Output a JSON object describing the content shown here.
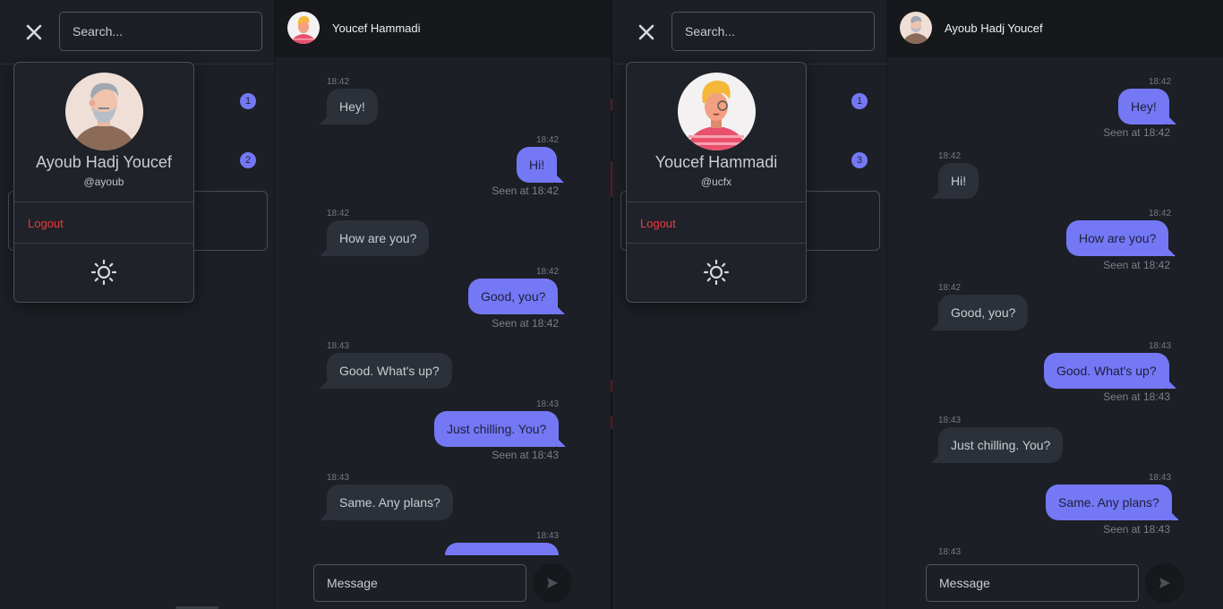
{
  "colors": {
    "accent": "#7478f5",
    "danger": "#f0383f",
    "background": "#1c1f25",
    "header": "#16181c",
    "incoming_bubble": "#2c3038"
  },
  "left": {
    "search": {
      "placeholder": "Search..."
    },
    "badges": [
      "1",
      "2"
    ],
    "profile": {
      "name": "Ayoub Hadj Youcef",
      "handle": "@ayoub",
      "logout_label": "Logout"
    },
    "chat": {
      "title": "Youcef Hammadi",
      "input_placeholder": "Message",
      "messages": [
        {
          "dir": "in",
          "time": "18:42",
          "text": "Hey!"
        },
        {
          "dir": "out",
          "time": "18:42",
          "text": "Hi!",
          "seen": "Seen at 18:42"
        },
        {
          "dir": "in",
          "time": "18:42",
          "text": "How are you?"
        },
        {
          "dir": "out",
          "time": "18:42",
          "text": "Good, you?",
          "seen": "Seen at 18:42"
        },
        {
          "dir": "in",
          "time": "18:43",
          "text": "Good. What's up?"
        },
        {
          "dir": "out",
          "time": "18:43",
          "text": "Just chilling. You?",
          "seen": "Seen at 18:43"
        },
        {
          "dir": "in",
          "time": "18:43",
          "text": "Same. Any plans?"
        },
        {
          "dir": "out",
          "time": "18:43",
          "text": ""
        }
      ]
    }
  },
  "right": {
    "search": {
      "placeholder": "Search..."
    },
    "badges": [
      "1",
      "3"
    ],
    "profile": {
      "name": "Youcef Hammadi",
      "handle": "@ucfx",
      "logout_label": "Logout"
    },
    "chat": {
      "title": "Ayoub Hadj Youcef",
      "input_placeholder": "Message",
      "messages": [
        {
          "dir": "out",
          "time": "18:42",
          "text": "Hey!",
          "seen": "Seen at 18:42"
        },
        {
          "dir": "in",
          "time": "18:42",
          "text": "Hi!"
        },
        {
          "dir": "out",
          "time": "18:42",
          "text": "How are you?",
          "seen": "Seen at 18:42"
        },
        {
          "dir": "in",
          "time": "18:42",
          "text": "Good, you?"
        },
        {
          "dir": "out",
          "time": "18:43",
          "text": "Good. What's up?",
          "seen": "Seen at 18:43"
        },
        {
          "dir": "in",
          "time": "18:43",
          "text": "Just chilling. You?"
        },
        {
          "dir": "out",
          "time": "18:43",
          "text": "Same. Any plans?",
          "seen": "Seen at 18:43"
        },
        {
          "dir": "in",
          "time": "18:43",
          "text": ""
        }
      ]
    }
  }
}
